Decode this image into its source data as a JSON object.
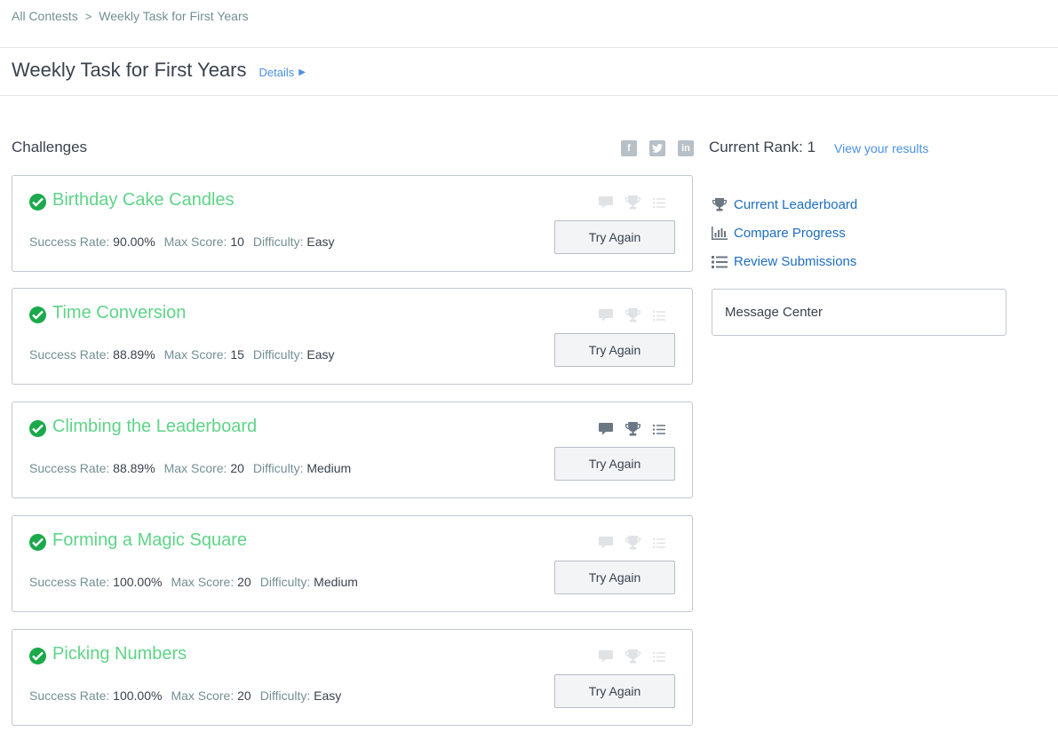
{
  "breadcrumb": {
    "items": [
      "All Contests",
      "Weekly Task for First Years"
    ],
    "separator": ">"
  },
  "header": {
    "title": "Weekly Task for First Years",
    "details_label": "Details",
    "details_icon": "play-triangle-icon"
  },
  "challenges": {
    "section_title": "Challenges",
    "labels": {
      "success_rate": "Success Rate:",
      "max_score": "Max Score:",
      "difficulty": "Difficulty:"
    },
    "button_label": "Try Again",
    "items": [
      {
        "name": "Birthday Cake Candles",
        "success_rate": "90.00%",
        "max_score": "10",
        "difficulty": "Easy",
        "solved": true,
        "icons_active": false
      },
      {
        "name": "Time Conversion",
        "success_rate": "88.89%",
        "max_score": "15",
        "difficulty": "Easy",
        "solved": true,
        "icons_active": false
      },
      {
        "name": "Climbing the Leaderboard",
        "success_rate": "88.89%",
        "max_score": "20",
        "difficulty": "Medium",
        "solved": true,
        "icons_active": true
      },
      {
        "name": "Forming a Magic Square",
        "success_rate": "100.00%",
        "max_score": "20",
        "difficulty": "Medium",
        "solved": true,
        "icons_active": false
      },
      {
        "name": "Picking Numbers",
        "success_rate": "100.00%",
        "max_score": "20",
        "difficulty": "Easy",
        "solved": true,
        "icons_active": false
      }
    ]
  },
  "share": {
    "icons": [
      "facebook-icon",
      "twitter-icon",
      "linkedin-icon"
    ]
  },
  "sidebar": {
    "rank_label": "Current Rank:",
    "rank_value": "1",
    "view_results": "View your results",
    "links": [
      {
        "label": "Current Leaderboard",
        "icon": "trophy-icon"
      },
      {
        "label": "Compare Progress",
        "icon": "bar-chart-icon"
      },
      {
        "label": "Review Submissions",
        "icon": "list-icon"
      }
    ],
    "message_center": "Message Center"
  },
  "colors": {
    "link": "#4a90e2",
    "challenge_name": "#5fd488",
    "check": "#1ba94c",
    "icon_inactive": "#dfe3e6",
    "icon_active": "#6b7783"
  }
}
